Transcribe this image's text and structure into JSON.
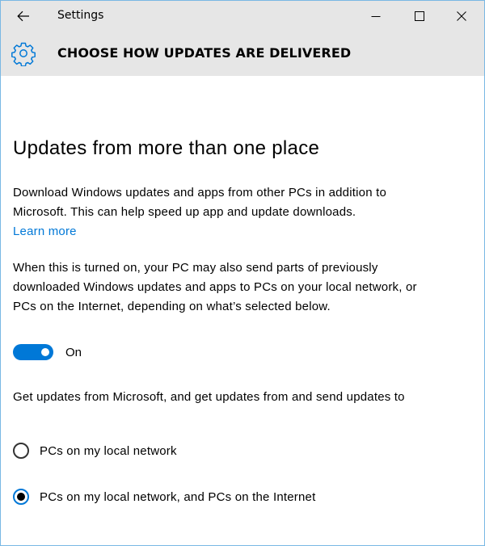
{
  "window": {
    "app_title": "Settings",
    "back_icon": "arrow-left-icon",
    "controls": {
      "minimize_icon": "minimize-icon",
      "maximize_icon": "maximize-icon",
      "close_icon": "close-icon"
    }
  },
  "header": {
    "icon": "gear-icon",
    "title": "CHOOSE HOW UPDATES ARE DELIVERED"
  },
  "main": {
    "section_title": "Updates from more than one place",
    "description": "Download Windows updates and apps from other PCs in addition to Microsoft. This can help speed up app and update downloads.",
    "learn_more_label": "Learn more",
    "details": "When this is turned on, your PC may also send parts of previously downloaded Windows updates and apps to PCs on your local network, or PCs on the Internet, depending on what’s selected below.",
    "toggle": {
      "state": true,
      "label": "On"
    },
    "options_prompt": "Get updates from Microsoft, and get updates from and send updates to",
    "options": [
      {
        "label": "PCs on my local network",
        "selected": false
      },
      {
        "label": "PCs on my local network, and PCs on the Internet",
        "selected": true
      }
    ]
  },
  "colors": {
    "accent": "#0078d7",
    "header_background": "#e6e6e6",
    "window_border": "#79b8e4"
  }
}
